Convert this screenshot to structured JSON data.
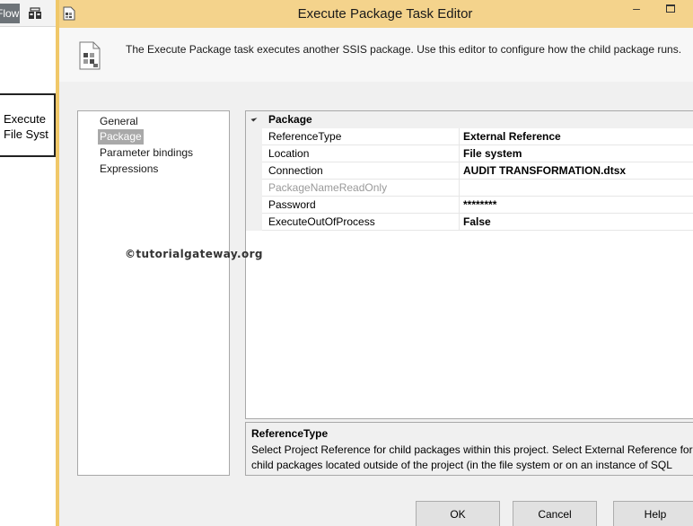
{
  "background_app": {
    "tab_label": "Flow",
    "task_box_label": "Execute\nFile Syst"
  },
  "dialog": {
    "title": "Execute Package Task Editor",
    "minimize_glyph": "–",
    "description": "The Execute Package task executes another SSIS package. Use this editor to configure how the child package runs."
  },
  "nav": {
    "items": [
      {
        "label": "General",
        "selected": false
      },
      {
        "label": "Package",
        "selected": true
      },
      {
        "label": "Parameter bindings",
        "selected": false
      },
      {
        "label": "Expressions",
        "selected": false
      }
    ]
  },
  "property_grid": {
    "category": "Package",
    "rows": [
      {
        "name": "ReferenceType",
        "value": "External Reference",
        "disabled": false
      },
      {
        "name": "Location",
        "value": "File system",
        "disabled": false
      },
      {
        "name": "Connection",
        "value": "AUDIT TRANSFORMATION.dtsx",
        "disabled": false
      },
      {
        "name": "PackageNameReadOnly",
        "value": "",
        "disabled": true
      },
      {
        "name": "Password",
        "value": "********",
        "disabled": false
      },
      {
        "name": "ExecuteOutOfProcess",
        "value": "False",
        "disabled": false
      }
    ]
  },
  "watermark": "©tutorialgateway.org",
  "help": {
    "title": "ReferenceType",
    "text": "Select Project Reference for child packages within this project. Select External Reference for child packages located outside of the project (in the file system or on an instance of SQL Se..."
  },
  "buttons": {
    "ok": "OK",
    "cancel": "Cancel",
    "help": "Help"
  },
  "colors": {
    "title_bar": "#f4d38c",
    "dialog_bg": "#f0f0f0",
    "selected_nav": "#a9a9a9"
  }
}
